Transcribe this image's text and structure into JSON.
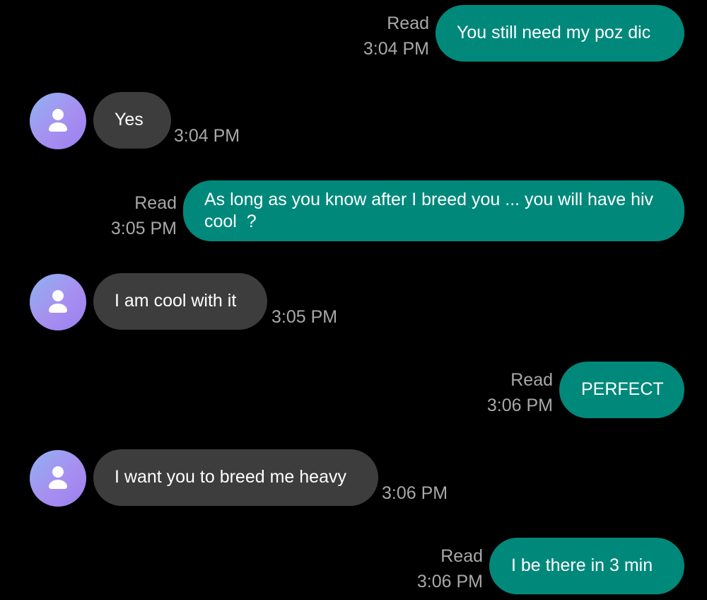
{
  "colors": {
    "background": "#000000",
    "outgoing_bubble": "#00897b",
    "incoming_bubble": "#3d3d3d",
    "meta_text": "#a8a8a8",
    "avatar_gradient": [
      "#8fb3f2",
      "#9a7ff0"
    ]
  },
  "messages": [
    {
      "direction": "outgoing",
      "text": "You still need my poz dic",
      "status": "Read",
      "time": "3:04 PM"
    },
    {
      "direction": "incoming",
      "text": "Yes",
      "time": "3:04 PM",
      "avatar_icon": "person-icon"
    },
    {
      "direction": "outgoing",
      "text": "As long as you know after I breed you ... you will have hiv cool  ?",
      "status": "Read",
      "time": "3:05 PM"
    },
    {
      "direction": "incoming",
      "text": "I am cool with it",
      "time": "3:05 PM",
      "avatar_icon": "person-icon"
    },
    {
      "direction": "outgoing",
      "text": "PERFECT",
      "status": "Read",
      "time": "3:06 PM"
    },
    {
      "direction": "incoming",
      "text": "I want you to breed me heavy",
      "time": "3:06 PM",
      "avatar_icon": "person-icon"
    },
    {
      "direction": "outgoing",
      "text": "I be there in 3 min",
      "status": "Read",
      "time": "3:06 PM"
    }
  ]
}
